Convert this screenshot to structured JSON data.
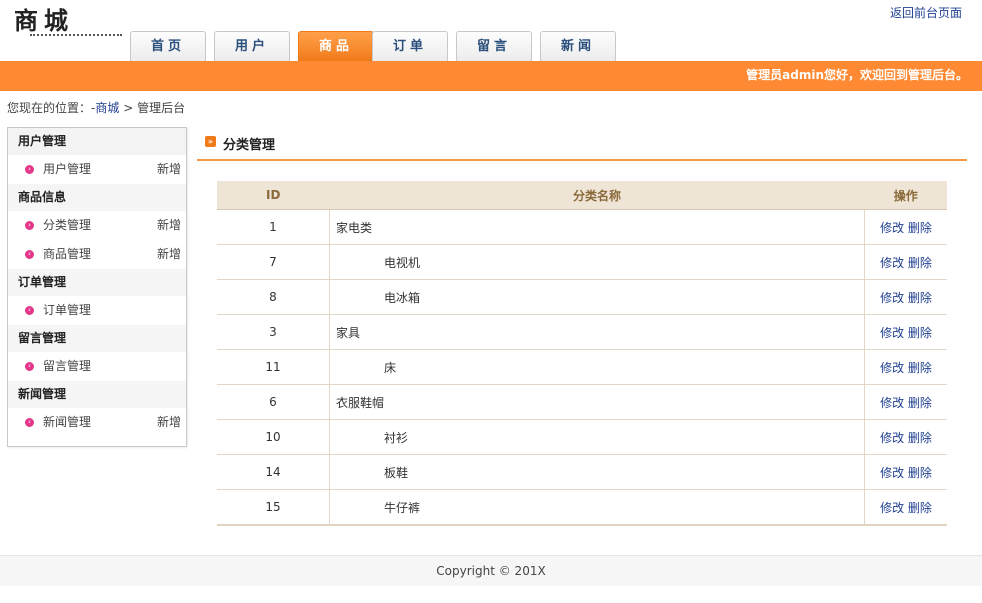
{
  "header": {
    "logo_text": "商城",
    "back_link": "返回前台页面",
    "tabs": [
      {
        "label": "首页"
      },
      {
        "label": "用户"
      },
      {
        "label": "商品"
      },
      {
        "label": "订单"
      },
      {
        "label": "留言"
      },
      {
        "label": "新闻"
      }
    ],
    "active_tab": "商品",
    "welcome": "管理员admin您好，欢迎回到管理后台。"
  },
  "breadcrumb": {
    "prefix": "您现在的位置：-",
    "link": "商城",
    "separator": ">",
    "current": "管理后台"
  },
  "sidebar": {
    "groups": [
      {
        "title": "用户管理",
        "items": [
          {
            "label": "用户管理",
            "add": "新增"
          }
        ]
      },
      {
        "title": "商品信息",
        "items": [
          {
            "label": "分类管理",
            "add": "新增"
          },
          {
            "label": "商品管理",
            "add": "新增"
          }
        ]
      },
      {
        "title": "订单管理",
        "items": [
          {
            "label": "订单管理",
            "add": ""
          }
        ]
      },
      {
        "title": "留言管理",
        "items": [
          {
            "label": "留言管理",
            "add": ""
          }
        ]
      },
      {
        "title": "新闻管理",
        "items": [
          {
            "label": "新闻管理",
            "add": "新增"
          }
        ]
      }
    ]
  },
  "main": {
    "title": "分类管理",
    "table": {
      "headers": {
        "id": "ID",
        "name": "分类名称",
        "ops": "操作"
      },
      "edit_label": "修改",
      "delete_label": "删除",
      "rows": [
        {
          "id": "1",
          "name": "家电类",
          "child": false
        },
        {
          "id": "7",
          "name": "电视机",
          "child": true
        },
        {
          "id": "8",
          "name": "电冰箱",
          "child": true
        },
        {
          "id": "3",
          "name": "家具",
          "child": false
        },
        {
          "id": "11",
          "name": "床",
          "child": true
        },
        {
          "id": "6",
          "name": "衣服鞋帽",
          "child": false
        },
        {
          "id": "10",
          "name": "衬衫",
          "child": true
        },
        {
          "id": "14",
          "name": "板鞋",
          "child": true
        },
        {
          "id": "15",
          "name": "牛仔裤",
          "child": true
        }
      ]
    }
  },
  "footer": {
    "copyright": "Copyright © 201X"
  },
  "colors": {
    "accent": "#ff8a33",
    "link": "#1f3f8f",
    "bullet": "#e4378b",
    "table_head": "#efe5d6"
  }
}
